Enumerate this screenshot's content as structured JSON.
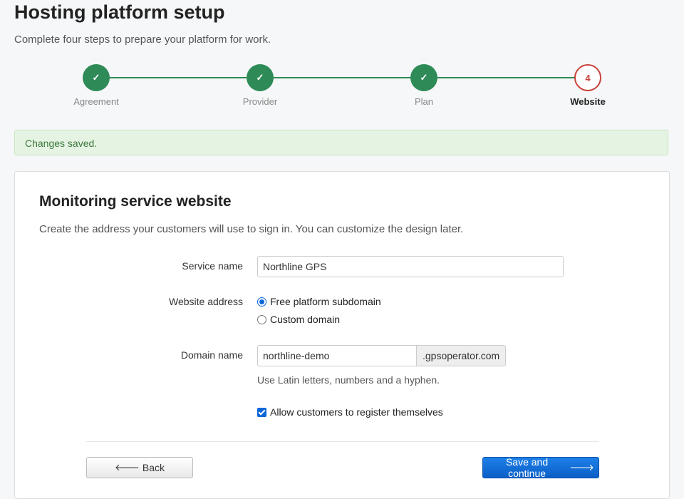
{
  "header": {
    "title": "Hosting platform setup",
    "subtitle": "Complete four steps to prepare your platform for work."
  },
  "stepper": {
    "steps": [
      {
        "label": "Agreement",
        "state": "done",
        "marker": "✓"
      },
      {
        "label": "Provider",
        "state": "done",
        "marker": "✓"
      },
      {
        "label": "Plan",
        "state": "done",
        "marker": "✓"
      },
      {
        "label": "Website",
        "state": "active",
        "marker": "4"
      }
    ]
  },
  "alert": {
    "message": "Changes saved."
  },
  "card": {
    "title": "Monitoring service website",
    "description": "Create the address your customers will use to sign in. You can customize the design later."
  },
  "form": {
    "service_name": {
      "label": "Service name",
      "value": "Northline GPS"
    },
    "website_address": {
      "label": "Website address",
      "options": [
        {
          "label": "Free platform subdomain",
          "checked": true
        },
        {
          "label": "Custom domain",
          "checked": false
        }
      ]
    },
    "domain_name": {
      "label": "Domain name",
      "value": "northline-demo",
      "suffix": ".gpsoperator.com",
      "help": "Use Latin letters, numbers and a hyphen."
    },
    "self_register": {
      "label": "Allow customers to register themselves",
      "checked": true
    }
  },
  "buttons": {
    "back": "Back",
    "save": "Save and continue"
  },
  "colors": {
    "step_done": "#2e8b57",
    "step_active": "#c9423b",
    "primary": "#0b67d8",
    "alert_bg": "#e5f4e2"
  }
}
